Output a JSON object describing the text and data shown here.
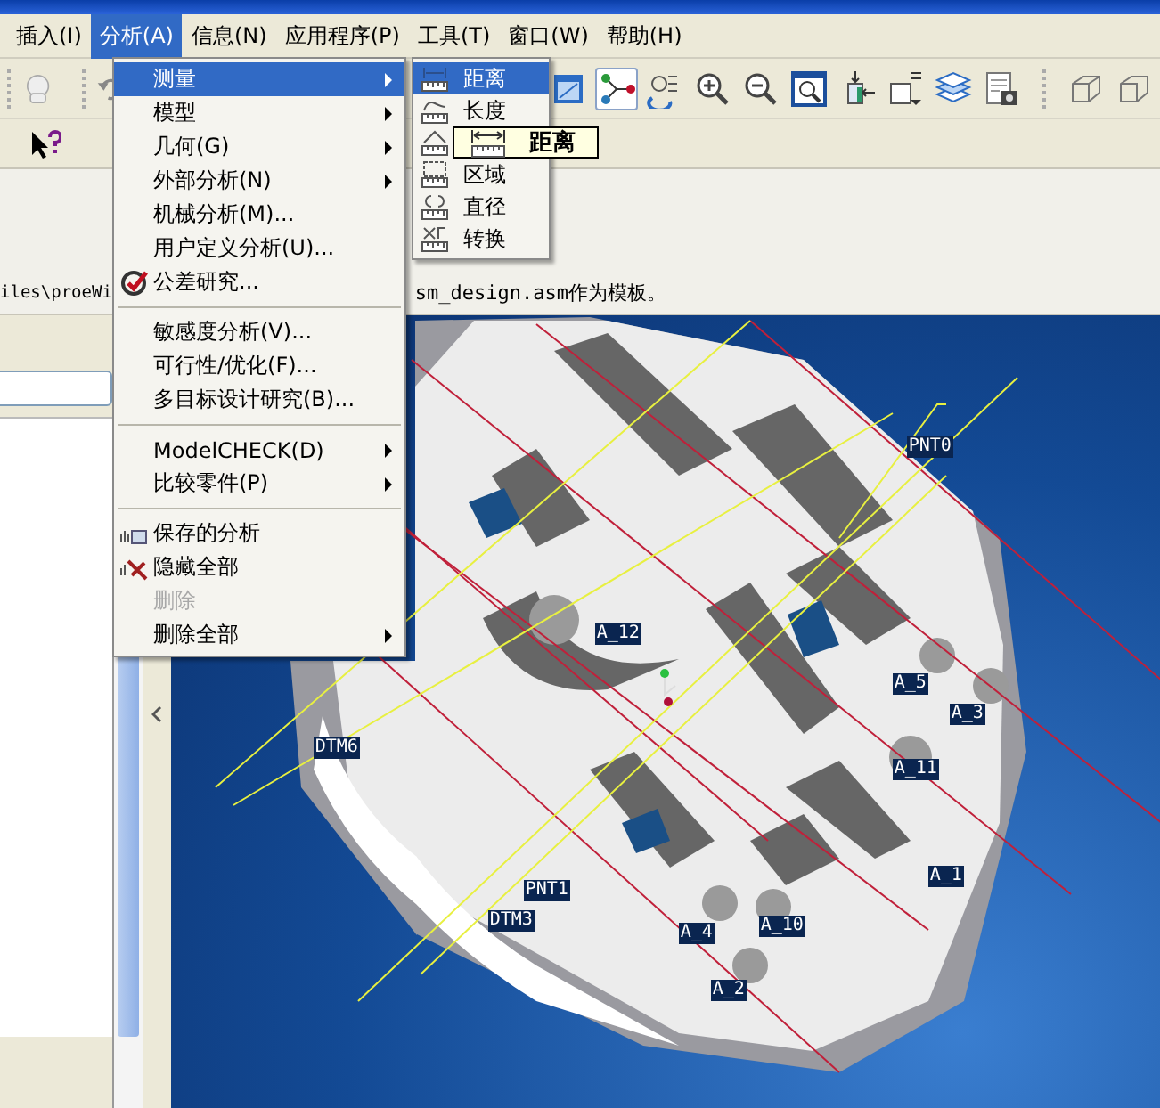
{
  "menubar": [
    {
      "label": "插入(I)",
      "selected": false
    },
    {
      "label": "分析(A)",
      "selected": true
    },
    {
      "label": "信息(N)",
      "selected": false
    },
    {
      "label": "应用程序(P)",
      "selected": false
    },
    {
      "label": "工具(T)",
      "selected": false
    },
    {
      "label": "窗口(W)",
      "selected": false
    },
    {
      "label": "帮助(H)",
      "selected": false
    }
  ],
  "view_toolbar": [
    {
      "kind": "plane",
      "selected": false
    },
    {
      "kind": "axis",
      "selected": true
    },
    {
      "kind": "center",
      "selected": false
    },
    {
      "kind": "zoomin",
      "selected": false
    },
    {
      "kind": "zoomout",
      "selected": false
    },
    {
      "kind": "refit",
      "selected": false
    },
    {
      "kind": "orient",
      "selected": false
    },
    {
      "kind": "views",
      "selected": false
    },
    {
      "kind": "layers",
      "selected": false
    },
    {
      "kind": "setup",
      "selected": false
    },
    {
      "kind": "wire",
      "selected": false
    },
    {
      "kind": "hidden",
      "selected": false
    }
  ],
  "message_parts": [
    "iles\\proeWi",
    "sm_design.asm作为模板。"
  ],
  "analysis_menu": [
    {
      "kind": "plain",
      "label": "测量",
      "selected": true,
      "submenu": true,
      "disabled": false
    },
    {
      "kind": "plain",
      "label": "模型",
      "selected": false,
      "submenu": true,
      "disabled": false
    },
    {
      "kind": "plain",
      "label": "几何(G)",
      "selected": false,
      "submenu": true,
      "disabled": false
    },
    {
      "kind": "plain",
      "label": "外部分析(N)",
      "selected": false,
      "submenu": true,
      "disabled": false
    },
    {
      "kind": "plain",
      "label": "机械分析(M)...",
      "selected": false,
      "submenu": false,
      "disabled": false
    },
    {
      "kind": "plain",
      "label": "用户定义分析(U)...",
      "selected": false,
      "submenu": false,
      "disabled": false
    },
    {
      "kind": "tolerance",
      "label": "公差研究...",
      "selected": false,
      "submenu": false,
      "disabled": false
    },
    {
      "kind": "separator"
    },
    {
      "kind": "plain",
      "label": "敏感度分析(V)...",
      "selected": false,
      "submenu": false,
      "disabled": false
    },
    {
      "kind": "plain",
      "label": "可行性/优化(F)...",
      "selected": false,
      "submenu": false,
      "disabled": false
    },
    {
      "kind": "plain",
      "label": "多目标设计研究(B)...",
      "selected": false,
      "submenu": false,
      "disabled": false
    },
    {
      "kind": "separator"
    },
    {
      "kind": "plain",
      "label": "ModelCHECK(D)",
      "selected": false,
      "submenu": true,
      "disabled": false
    },
    {
      "kind": "plain",
      "label": "比较零件(P)",
      "selected": false,
      "submenu": true,
      "disabled": false
    },
    {
      "kind": "separator"
    },
    {
      "kind": "saved",
      "label": "保存的分析",
      "selected": false,
      "submenu": false,
      "disabled": false
    },
    {
      "kind": "hide",
      "label": "隐藏全部",
      "selected": false,
      "submenu": false,
      "disabled": false
    },
    {
      "kind": "plain",
      "label": "删除",
      "selected": false,
      "submenu": false,
      "disabled": true
    },
    {
      "kind": "plain",
      "label": "删除全部",
      "selected": false,
      "submenu": true,
      "disabled": false
    }
  ],
  "measure_submenu": [
    {
      "label": "距离",
      "selected": true
    },
    {
      "label": "长度",
      "selected": false
    },
    {
      "selected": false
    },
    {
      "label": "区域",
      "selected": false
    },
    {
      "label": "直径",
      "selected": false
    },
    {
      "label": "转换",
      "selected": false
    }
  ],
  "tooltip": {
    "label": "距离"
  },
  "datum_labels": [
    {
      "label": "PNT0"
    },
    {
      "label": "A_12"
    },
    {
      "label": "A_5"
    },
    {
      "label": "A_3"
    },
    {
      "label": "A_11"
    },
    {
      "label": "DTM6"
    },
    {
      "label": "A_1"
    },
    {
      "label": "PNT1"
    },
    {
      "label": "DTM3"
    },
    {
      "label": "A_4"
    },
    {
      "label": "A_10"
    },
    {
      "label": "A_2"
    }
  ]
}
